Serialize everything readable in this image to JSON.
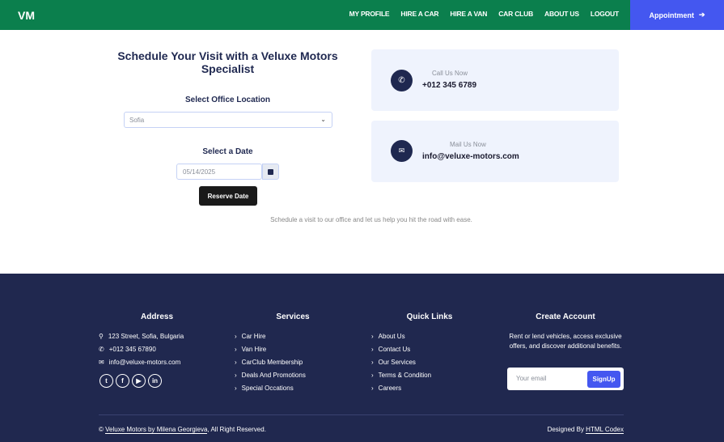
{
  "colors": {
    "nav": "#0b7f4d",
    "accent": "#4457f0",
    "footer": "#20284f",
    "card": "#eff3fd"
  },
  "nav": {
    "logo": "VM",
    "items": [
      "MY PROFILE",
      "HIRE A CAR",
      "HIRE A VAN",
      "CAR CLUB",
      "ABOUT US",
      "LOGOUT"
    ],
    "appointment": "Appointment"
  },
  "form": {
    "title": "Schedule Your Visit with a Veluxe Motors Specialist",
    "location_label": "Select Office Location",
    "location_value": "Sofia",
    "date_label": "Select a Date",
    "date_value": "05/14/2025",
    "reserve": "Reserve Date",
    "tagline": "Schedule a visit to our office and let us help you hit the road with ease."
  },
  "contact": {
    "call_label": "Call Us Now",
    "call_value": "+012 345 6789",
    "mail_label": "Mail Us Now",
    "mail_value": "info@veluxe-motors.com"
  },
  "footer": {
    "address": {
      "title": "Address",
      "street": "123 Street, Sofia, Bulgaria",
      "phone": "+012 345 67890",
      "email": "info@veluxe-motors.com"
    },
    "services": {
      "title": "Services",
      "items": [
        "Car Hire",
        "Van Hire",
        "CarClub Membership",
        "Deals And Promotions",
        "Special Occations"
      ]
    },
    "quick": {
      "title": "Quick Links",
      "items": [
        "About Us",
        "Contact Us",
        "Our Services",
        "Terms & Condition",
        "Careers"
      ]
    },
    "account": {
      "title": "Create Account",
      "text": "Rent or lend vehicles, access exclusive offers, and discover additional benefits.",
      "placeholder": "Your email",
      "signup": "SignUp"
    },
    "copyright_prefix": "©",
    "copyright_link": "Veluxe Motors by Milena Georgieva",
    "copyright_suffix": ", All Right Reserved.",
    "designed_prefix": "Designed By",
    "designed_link": "HTML Codex"
  }
}
